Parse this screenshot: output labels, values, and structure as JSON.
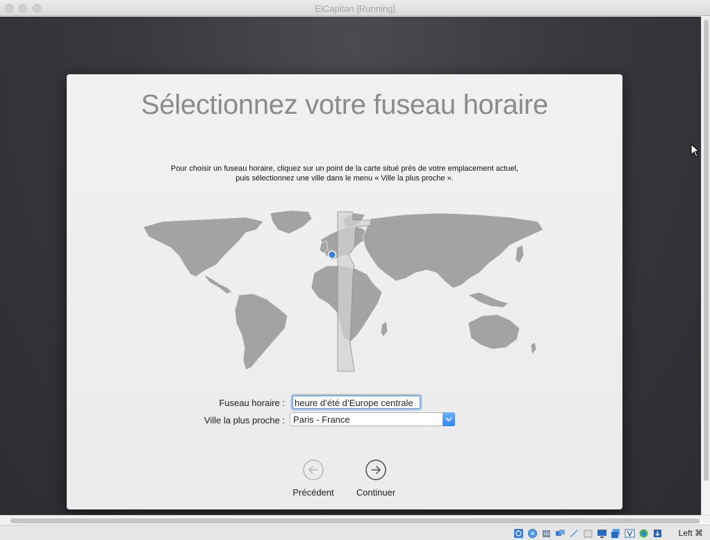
{
  "window": {
    "title": "ElCapitan [Running]"
  },
  "installer": {
    "title": "Sélectionnez votre fuseau horaire",
    "instructions_line1": "Pour choisir un fuseau horaire, cliquez sur un point de la carte situé près de votre emplacement actuel,",
    "instructions_line2": "puis sélectionnez une ville dans le menu « Ville la plus proche »."
  },
  "form": {
    "timezone_label": "Fuseau horaire :",
    "timezone_value": "heure d’été d’Europe centrale",
    "city_label": "Ville la plus proche :",
    "city_value": "Paris - France"
  },
  "buttons": {
    "back_label": "Précédent",
    "continue_label": "Continuer"
  },
  "statusbar": {
    "host_key": "Left ⌘",
    "icons": [
      "hard-disk-icon",
      "optical-drive-icon",
      "audio-icon",
      "network-icon",
      "usb-icon",
      "shared-folders-icon",
      "display-icon",
      "screen-capture-icon",
      "video-recording-icon",
      "cpu-icon",
      "mouse-integration-icon",
      "keyboard-capture-icon"
    ]
  },
  "colors": {
    "accent": "#2f86f0",
    "map_land": "#a3a3a3",
    "map_selected_zone": "#d2d2d2",
    "location_pin": "#3d82e0"
  }
}
